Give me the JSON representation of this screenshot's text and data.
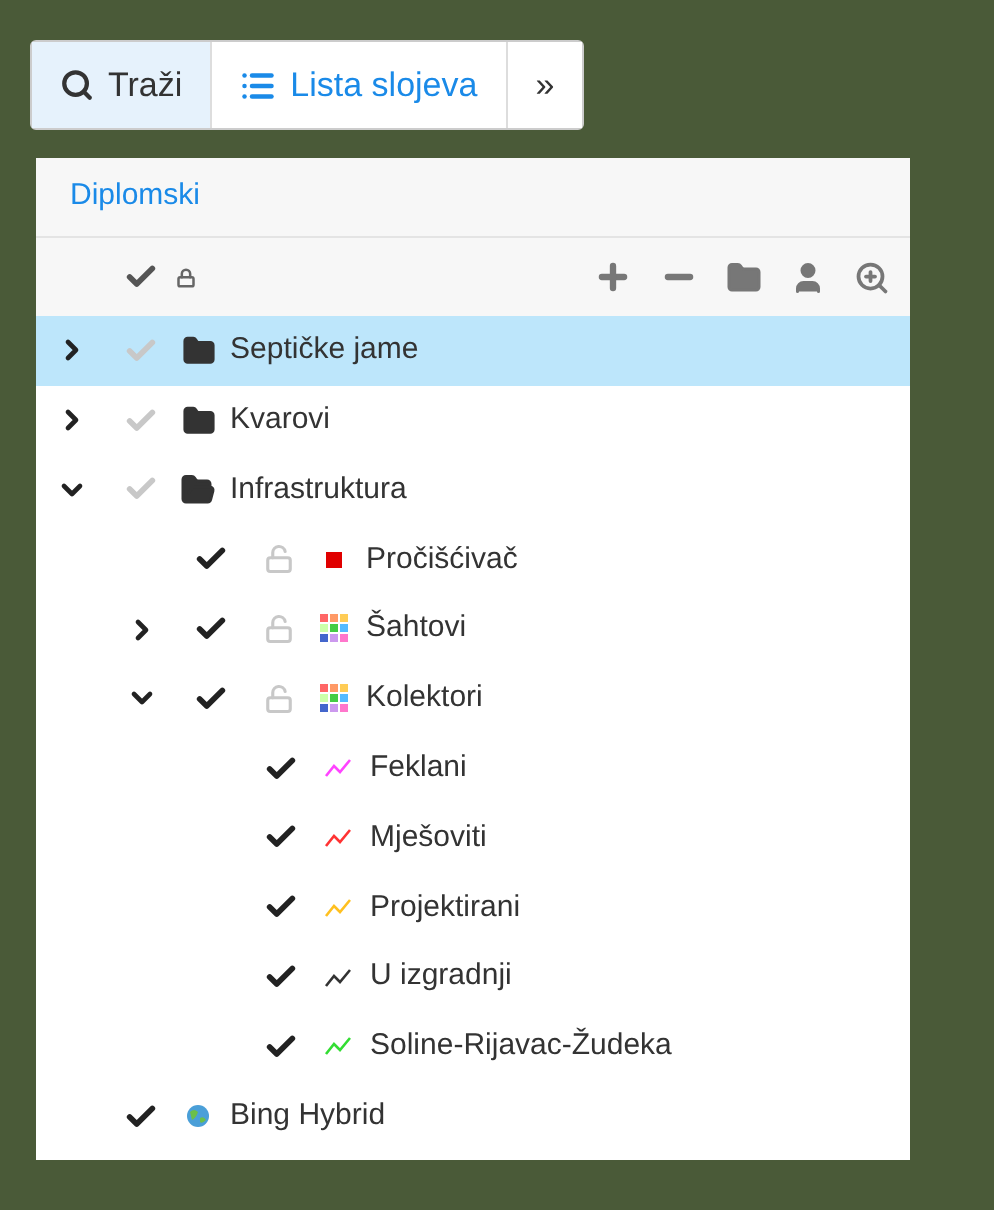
{
  "toolbar": [
    {
      "kind": "search",
      "label": "Traži",
      "selected": false,
      "highlighted": true
    },
    {
      "kind": "list",
      "label": "Lista slojeva",
      "selected": true,
      "highlighted": false
    },
    {
      "kind": "more",
      "label": "»",
      "selected": false,
      "highlighted": false
    }
  ],
  "panel": {
    "title": "Diplomski",
    "tree": [
      {
        "label": "Septičke jame",
        "selected": true,
        "expanded": false,
        "checked": false,
        "kind": "folder"
      },
      {
        "label": "Kvarovi",
        "selected": false,
        "expanded": false,
        "checked": false,
        "kind": "folder"
      },
      {
        "label": "Infrastruktura",
        "selected": false,
        "expanded": true,
        "checked": false,
        "kind": "folder",
        "children": [
          {
            "label": "Pročišćivač",
            "selected": false,
            "checked": true,
            "locked": false,
            "kind": "point",
            "color": "#e00000"
          },
          {
            "label": "Šahtovi",
            "selected": false,
            "expanded": false,
            "checked": true,
            "locked": false,
            "kind": "group"
          },
          {
            "label": "Kolektori",
            "selected": false,
            "expanded": true,
            "checked": true,
            "locked": false,
            "kind": "group",
            "children": [
              {
                "label": "Feklani",
                "selected": false,
                "checked": true,
                "kind": "line",
                "color": "#ff44ff"
              },
              {
                "label": "Mješoviti",
                "selected": false,
                "checked": true,
                "kind": "line",
                "color": "#ff3333"
              },
              {
                "label": "Projektirani",
                "selected": false,
                "checked": true,
                "kind": "line",
                "color": "#ffc020"
              },
              {
                "label": "U izgradnji",
                "selected": false,
                "checked": true,
                "kind": "line",
                "color": "#333333"
              },
              {
                "label": "Soline-Rijavac-Žudeka",
                "selected": false,
                "checked": true,
                "kind": "line",
                "color": "#33dd33"
              }
            ]
          }
        ]
      },
      {
        "label": "Bing Hybrid",
        "selected": false,
        "checked": true,
        "kind": "basemap"
      }
    ]
  }
}
